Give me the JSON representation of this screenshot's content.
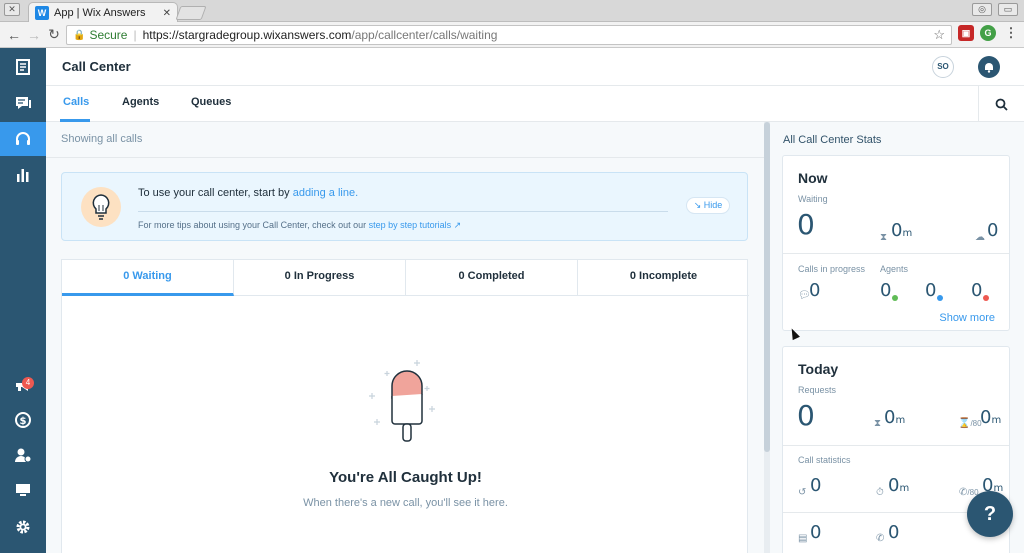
{
  "browser": {
    "tab_title": "App | Wix Answers",
    "tab_icon": "wix-answers-favicon",
    "secure_label": "Secure",
    "url_host": "https://stargradegroup.wixanswers.com",
    "url_path": "/app/callcenter/calls/waiting"
  },
  "sidebar": {
    "items": [
      {
        "icon": "tickets-icon"
      },
      {
        "icon": "chat-icon"
      },
      {
        "icon": "headset-icon",
        "active": true
      },
      {
        "icon": "reports-icon"
      }
    ],
    "bottom_items": [
      {
        "icon": "megaphone-icon",
        "badge": "4"
      },
      {
        "icon": "dollar-icon"
      },
      {
        "icon": "user-settings-icon"
      },
      {
        "icon": "monitor-icon"
      },
      {
        "icon": "gear-icon"
      }
    ]
  },
  "header": {
    "title": "Call Center",
    "avatar_initials": "SO"
  },
  "subnav": {
    "tabs": [
      {
        "label": "Calls",
        "active": true
      },
      {
        "label": "Agents"
      },
      {
        "label": "Queues"
      }
    ]
  },
  "main": {
    "showing": "Showing all calls",
    "tip": {
      "text": "To use your call center, start by",
      "link": "adding a line.",
      "sub_text": "For more tips about using your Call Center, check out our",
      "sub_link": "step by step tutorials ↗",
      "hide_label": "↘ Hide"
    },
    "call_tabs": [
      {
        "label": "0 Waiting",
        "active": true
      },
      {
        "label": "0 In Progress"
      },
      {
        "label": "0 Completed"
      },
      {
        "label": "0 Incomplete"
      }
    ],
    "empty": {
      "title": "You're All Caught Up!",
      "subtitle": "When there's a new call, you'll see it here."
    }
  },
  "stats": {
    "title": "All Call Center Stats",
    "now": {
      "title": "Now",
      "waiting_label": "Waiting",
      "waiting_value": "0",
      "wait_time_value": "0",
      "wait_time_unit": "m",
      "callback_value": "0",
      "in_progress_label": "Calls in progress",
      "in_progress_value": "0",
      "agents_label": "Agents",
      "agents_available": "0",
      "agents_busy": "0",
      "agents_offline": "0",
      "show_more": "Show more"
    },
    "today": {
      "title": "Today",
      "requests_label": "Requests",
      "requests_value": "0",
      "avg_time_value": "0",
      "avg_time_unit": "m",
      "sla_prefix": "/80",
      "sla_value": "0",
      "sla_unit": "m",
      "call_stats_label": "Call statistics",
      "stat_1": "0",
      "stat_2_value": "0",
      "stat_2_unit": "m",
      "stat_3_prefix": "/80",
      "stat_3_value": "0",
      "stat_3_unit": "m",
      "stat_4": "0",
      "stat_5": "0"
    }
  },
  "help_label": "?",
  "colors": {
    "sidebar": "#2b5672",
    "accent": "#3899ec",
    "available": "#60bc57",
    "busy": "#3899ec",
    "offline": "#ee5951"
  }
}
